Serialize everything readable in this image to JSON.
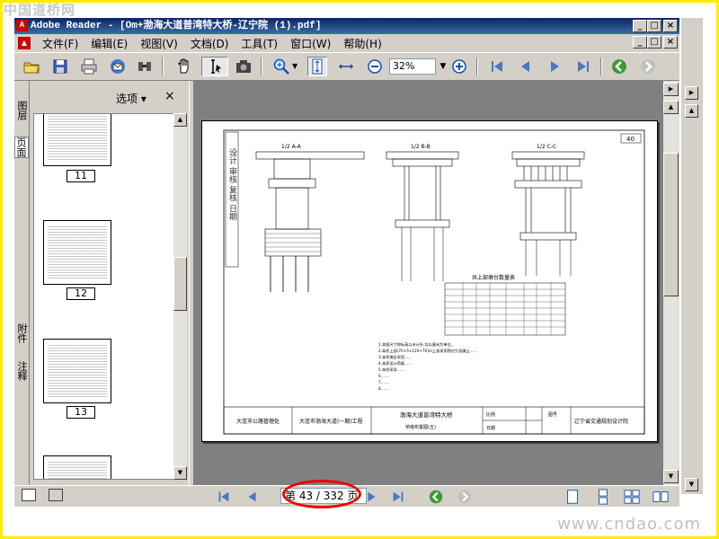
{
  "watermarks": {
    "top": "中国道桥网",
    "bottom": "www.cndao.com"
  },
  "window": {
    "title": "Adobe Reader - [Om+渤海大道普湾特大桥-辽宁院 (1).pdf]",
    "buttons": {
      "minimize": "_",
      "restore": "□",
      "close": "×"
    }
  },
  "menu": [
    "文件(F)",
    "编辑(E)",
    "视图(V)",
    "文档(D)",
    "工具(T)",
    "窗口(W)",
    "帮助(H)"
  ],
  "toolbar": {
    "zoom_value": "32%",
    "icons": [
      "open-icon",
      "save-icon",
      "print-icon",
      "email-icon",
      "search-icon",
      "hand-icon",
      "select-text-icon",
      "snapshot-icon",
      "zoom-icon",
      "fit-page-icon",
      "fit-width-icon",
      "zoom-out-icon",
      "zoom-in-icon",
      "first-page-icon",
      "prev-page-icon",
      "next-page-icon",
      "last-page-icon",
      "back-icon",
      "forward-icon"
    ]
  },
  "left_tabs": [
    "图层",
    "页面",
    "附件",
    "注释"
  ],
  "panel": {
    "options_label": "选项 ▾",
    "close_label": "×",
    "thumbnails": [
      {
        "label": "11"
      },
      {
        "label": "12"
      },
      {
        "label": "13"
      }
    ]
  },
  "document": {
    "page_corner_number": "40",
    "section_labels": [
      "1/2 A-A",
      "1/2 B-B",
      "1/2 C-C"
    ],
    "table_title": "共上部墩台数量表",
    "notes": [
      "1.本图尺寸除标高以米计外,均以厘米为单位。",
      "2.本桥上部(70+5×120+70)m上部采用预应力混凝土……",
      "3.本桥墩台采用……",
      "4.本桥设计荷载……",
      "5.本桥采用……",
      "6.……",
      "7.……",
      "8.……"
    ],
    "titleblock": {
      "owner": "大连市公路管理处",
      "project": "大连市渤海大道(一期)工程",
      "drawing_name": "渤海大道普湾特大桥",
      "drawing_sub": "桥墩布置图(五)",
      "scale_label": "比例",
      "date_label": "日期",
      "sheet_label": "图号",
      "designer": "辽宁省交通规划设计院"
    },
    "stamp_text": "设计 审核 复核 日期"
  },
  "statusbar": {
    "page_display": "第 43 / 332 页"
  }
}
